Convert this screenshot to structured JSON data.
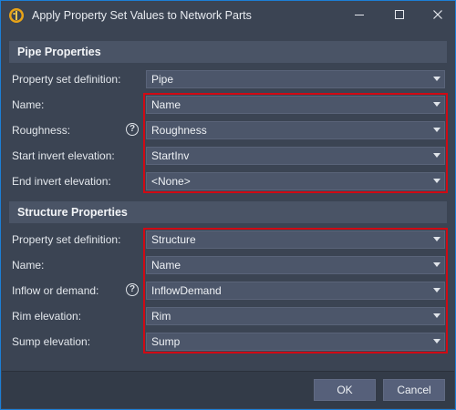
{
  "window": {
    "title": "Apply Property Set Values to Network Parts",
    "minimize_label": "Minimize",
    "maximize_label": "Maximize",
    "close_label": "Close"
  },
  "pipe": {
    "header": "Pipe Properties",
    "rows": [
      {
        "label": "Property set definition:",
        "value": "Pipe"
      },
      {
        "label": "Name:",
        "value": "Name"
      },
      {
        "label": "Roughness:",
        "value": "Roughness"
      },
      {
        "label": "Start invert elevation:",
        "value": "StartInv"
      },
      {
        "label": "End invert elevation:",
        "value": "<None>"
      }
    ]
  },
  "structure": {
    "header": "Structure Properties",
    "rows": [
      {
        "label": "Property set definition:",
        "value": "Structure"
      },
      {
        "label": "Name:",
        "value": "Name"
      },
      {
        "label": "Inflow or demand:",
        "value": "InflowDemand"
      },
      {
        "label": "Rim elevation:",
        "value": "Rim"
      },
      {
        "label": "Sump elevation:",
        "value": "Sump"
      }
    ]
  },
  "help_glyph": "?",
  "buttons": {
    "ok": "OK",
    "cancel": "Cancel"
  },
  "colors": {
    "accent_border": "#1c7fd6",
    "highlight": "#d00a14",
    "background": "#3b4453",
    "section_header": "#4a5466"
  },
  "icons": {
    "app": "civil3d-app-icon",
    "help": "help-icon",
    "dropdown": "chevron-down-icon"
  }
}
